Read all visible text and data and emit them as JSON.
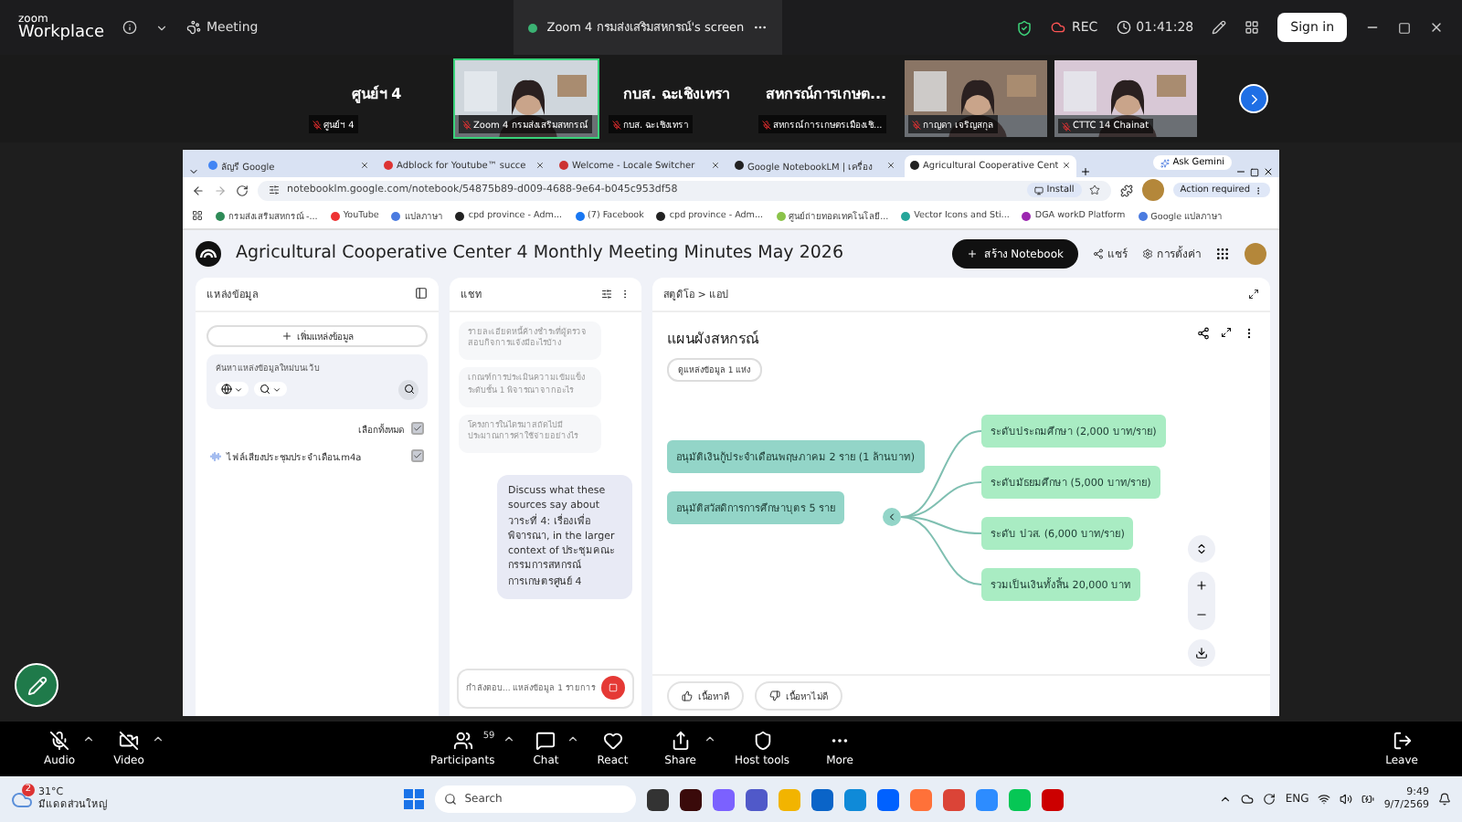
{
  "zoom_bar": {
    "brand_top": "zoom",
    "brand": "Workplace",
    "meeting_label": "Meeting",
    "share_title": "Zoom 4 กรมส่งเสริมสหกรณ์'s screen",
    "rec": "REC",
    "timer": "01:41:28",
    "sign_in": "Sign in"
  },
  "gallery": [
    {
      "kind": "name",
      "name": "ศูนย์ฯ 4",
      "label": "ศูนย์ฯ 4",
      "selected": false
    },
    {
      "kind": "video",
      "label": "Zoom 4 กรมส่งเสริมสหกรณ์",
      "selected": true
    },
    {
      "kind": "name",
      "name": "กบส. ฉะเชิงเทรา",
      "label": "กบส. ฉะเชิงเทรา",
      "selected": false
    },
    {
      "kind": "name",
      "name": "สหกรณ์การเกษต...",
      "label": "สหกรณ์การเกษตรเมืองเชิ...",
      "selected": false
    },
    {
      "kind": "video",
      "label": "กาญดา เจริญสกุล",
      "selected": false
    },
    {
      "kind": "video",
      "label": "CTTC 14 Chainat",
      "selected": false
    }
  ],
  "browser": {
    "tabs": [
      {
        "label": "ลัญรี Google",
        "selected": false
      },
      {
        "label": "Adblock for Youtube™ succe",
        "selected": false
      },
      {
        "label": "Welcome - Locale Switcher",
        "selected": false
      },
      {
        "label": "Google NotebookLM | เครื่อง",
        "selected": false
      },
      {
        "label": "Agricultural Cooperative Cent",
        "selected": true
      }
    ],
    "ask_gemini": "Ask Gemini",
    "url": "notebooklm.google.com/notebook/54875b89-d009-4688-9e64-b045c953df58",
    "install": "Install",
    "action": "Action required",
    "bookmarks": [
      "กรมส่งเสริมสหกรณ์ -...",
      "YouTube",
      "แปลภาษา",
      "cpd province - Adm...",
      "(7) Facebook",
      "cpd province - Adm...",
      "ศูนย์ถ่ายทอดเทคโนโลยี...",
      "Vector Icons and Sti...",
      "DGA workD Platform",
      "Google แปลภาษา"
    ]
  },
  "notebook": {
    "title": "Agricultural Cooperative Center 4 Monthly Meeting Minutes May 2026",
    "create": "สร้าง Notebook",
    "share": "แชร์",
    "settings": "การตั้งค่า"
  },
  "sources": {
    "title": "แหล่งข้อมูล",
    "add": "เพิ่มแหล่งข้อมูล",
    "search_placeholder": "ค้นหาแหล่งข้อมูลใหม่บนเว็บ",
    "select_all": {
      "label": "เลือกทั้งหมด",
      "checked": true
    },
    "items": [
      {
        "name": "ไฟล์เสียงประชุมประจำเดือน.m4a",
        "checked": true
      }
    ]
  },
  "chat": {
    "title": "แชท",
    "suggestions": [
      "รายละเอียดหนี้ค้างชำระที่ผู้ตรวจสอบกิจการแจ้งมีอะไรบ้าง",
      "เกณฑ์การประเมินความเข้มแข็งระดับชั้น 1 พิจารณาจากอะไร",
      "โครงการในไตรมาสถัดไปมีประมาณการค่าใช้จ่ายอย่างไร"
    ],
    "message": "Discuss what these sources say about วาระที่ 4: เรื่องเพื่อพิจารณา, in the larger context of ประชุมคณะกรรมการสหกรณ์การเกษตรศูนย์ 4",
    "input_status": "กำลังตอบ...",
    "input_sources": "แหล่งข้อมูล 1 รายการ"
  },
  "studio": {
    "breadcrumb": "สตูดิโอ > แอป",
    "title": "แผนผังสหกรณ์",
    "source_chip": "ดูแหล่งข้อมูล 1 แห่ง",
    "topics": [
      {
        "label": "อนุมัติเงินกู้ประจำเดือนพฤษภาคม 2 ราย (1 ล้านบาท)"
      },
      {
        "label": "อนุมัติสวัสดิการการศึกษาบุตร 5 ราย",
        "expanded": true,
        "children": [
          {
            "label": "ระดับประถมศึกษา (2,000 บาท/ราย)"
          },
          {
            "label": "ระดับมัธยมศึกษา (5,000 บาท/ราย)"
          },
          {
            "label": "ระดับ ปวส. (6,000 บาท/ราย)"
          },
          {
            "label": "รวมเป็นเงินทั้งสิ้น 20,000 บาท"
          }
        ]
      }
    ],
    "like": "เนื้อหาดี",
    "dislike": "เนื้อหาไม่ดี"
  },
  "controls": [
    {
      "kind": "audio",
      "label": "Audio"
    },
    {
      "kind": "video",
      "label": "Video"
    },
    {
      "kind": "participants",
      "label": "Participants",
      "count": "59"
    },
    {
      "kind": "chat",
      "label": "Chat"
    },
    {
      "kind": "react",
      "label": "React"
    },
    {
      "kind": "share",
      "label": "Share"
    },
    {
      "kind": "host",
      "label": "Host tools"
    },
    {
      "kind": "more",
      "label": "More"
    },
    {
      "kind": "leave",
      "label": "Leave"
    }
  ],
  "taskbar": {
    "weather_badge": "2",
    "temperature": "31°C",
    "weather": "มีแดดส่วนใหญ่",
    "search": "Search",
    "language": "ENG",
    "time": "9:49",
    "date": "9/7/2569"
  }
}
